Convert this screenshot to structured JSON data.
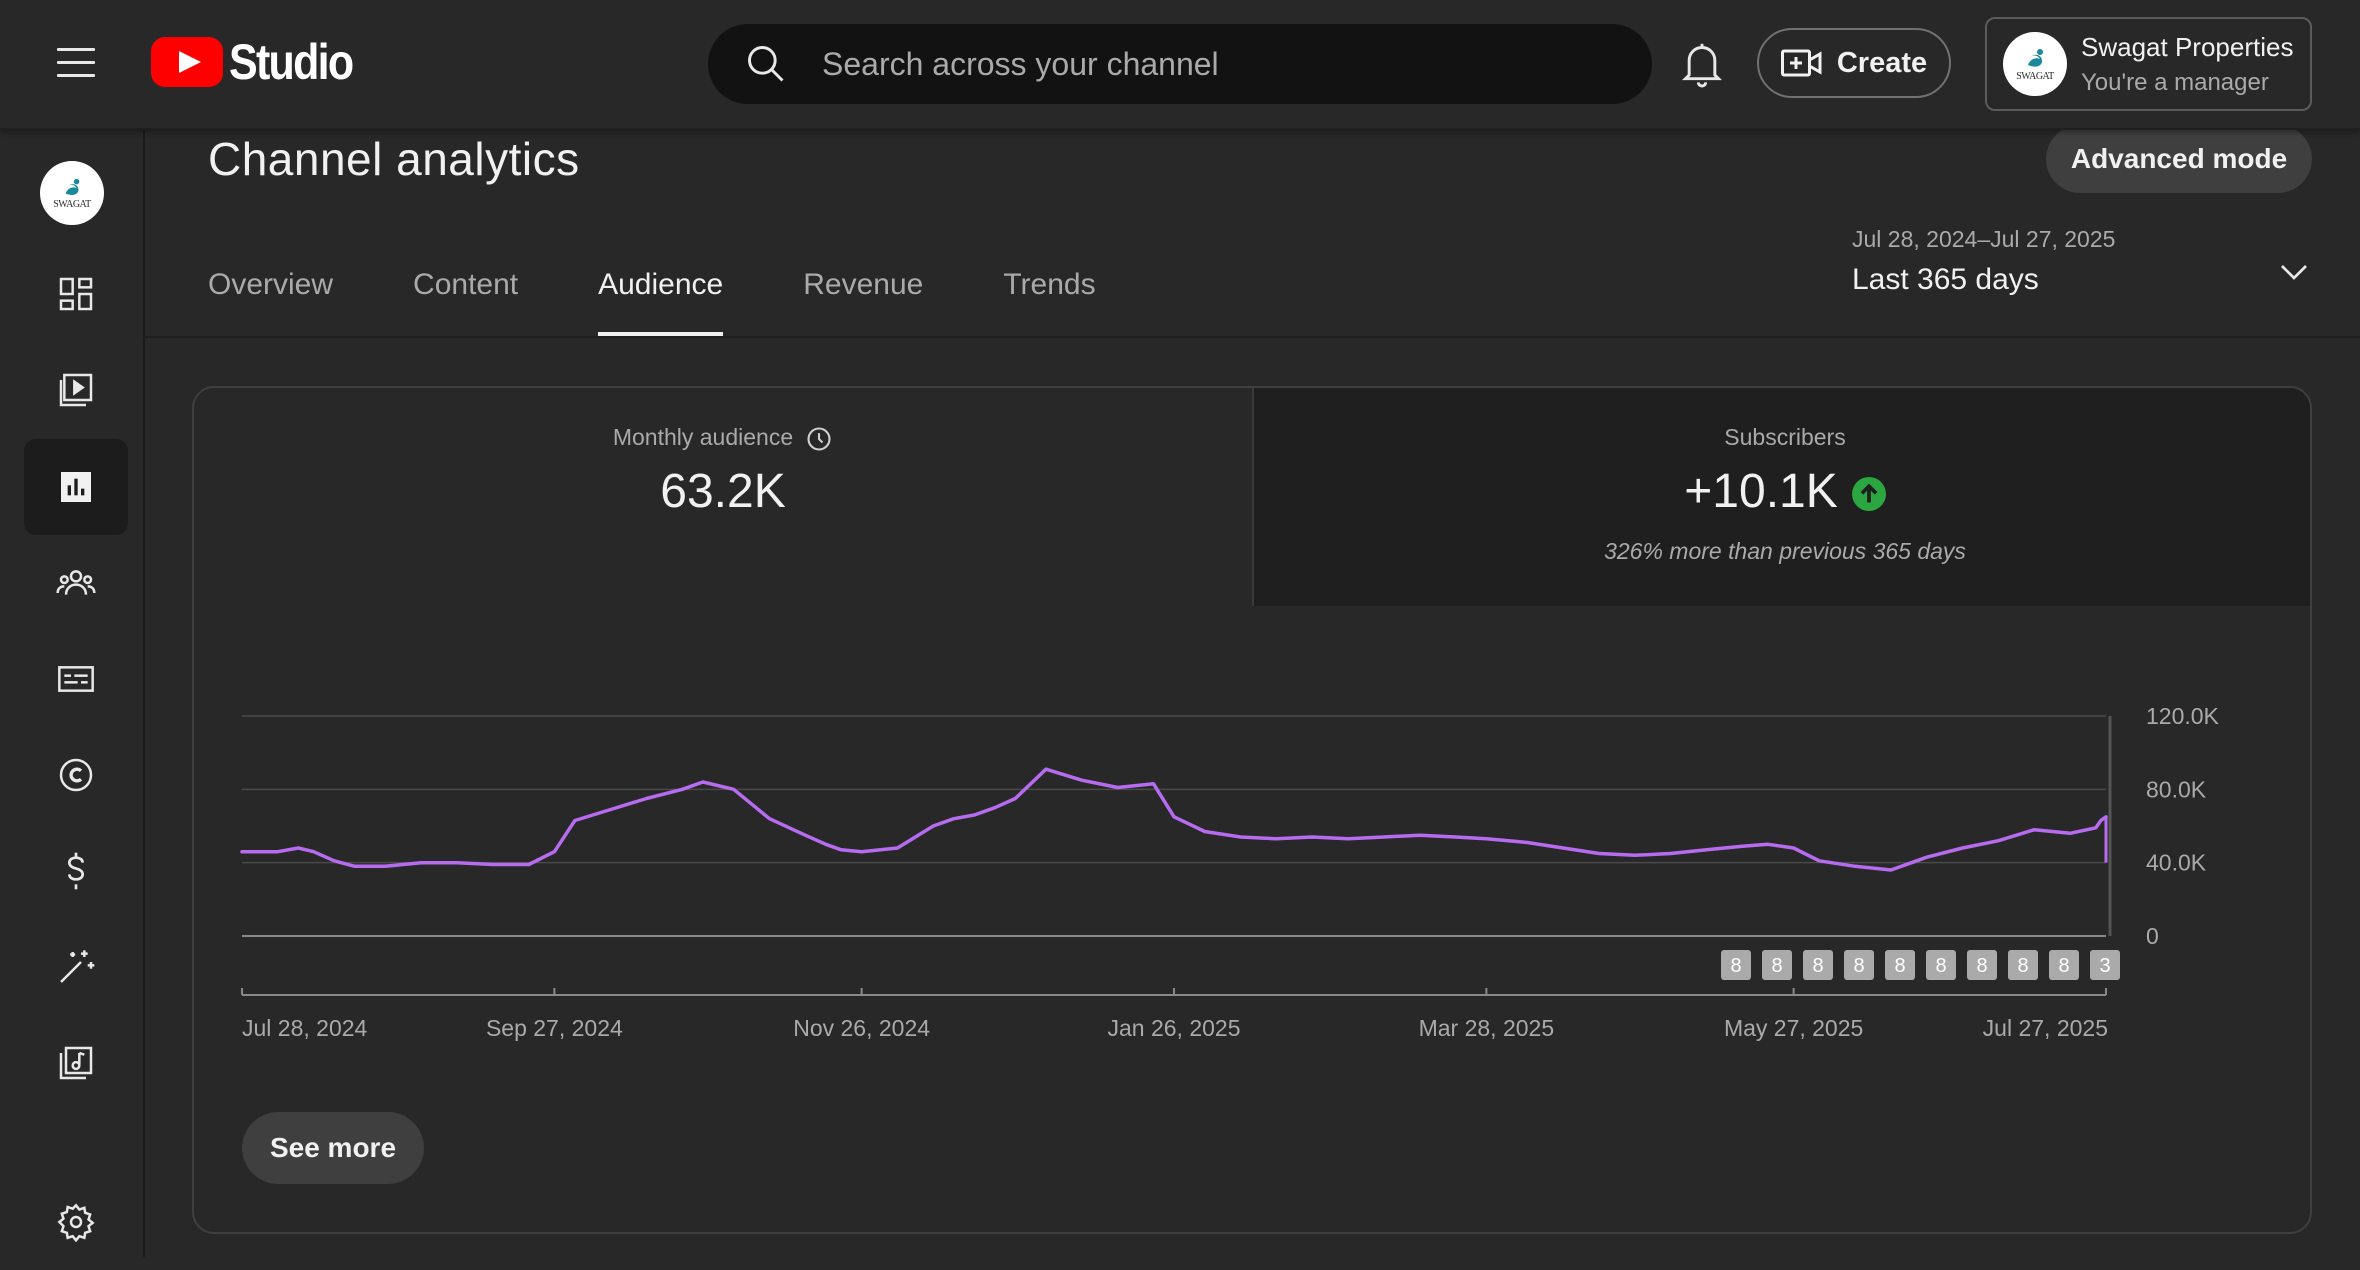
{
  "header": {
    "logo_text": "Studio",
    "search_placeholder": "Search across your channel",
    "create_label": "Create",
    "account_name": "Swagat Properties",
    "account_role": "You're a manager",
    "avatar_text": "SWAGAT"
  },
  "sidebar": {
    "items": [
      {
        "name": "dashboard",
        "icon": "dashboard-icon"
      },
      {
        "name": "content",
        "icon": "content-icon"
      },
      {
        "name": "analytics",
        "icon": "analytics-icon",
        "active": true
      },
      {
        "name": "community",
        "icon": "community-icon"
      },
      {
        "name": "subtitles",
        "icon": "subtitles-icon"
      },
      {
        "name": "copyright",
        "icon": "copyright-icon"
      },
      {
        "name": "earn",
        "icon": "dollar-icon"
      },
      {
        "name": "customization",
        "icon": "magic-wand-icon"
      },
      {
        "name": "audio-library",
        "icon": "audio-library-icon"
      },
      {
        "name": "settings",
        "icon": "gear-icon"
      }
    ]
  },
  "main": {
    "title": "Channel analytics",
    "advanced_mode_label": "Advanced mode",
    "tabs": [
      "Overview",
      "Content",
      "Audience",
      "Revenue",
      "Trends"
    ],
    "active_tab": "Audience",
    "date_range": "Jul 28, 2024–Jul 27, 2025",
    "date_period": "Last 365 days"
  },
  "metrics": {
    "monthly_audience_label": "Monthly audience",
    "monthly_audience_value": "63.2K",
    "subscribers_label": "Subscribers",
    "subscribers_value": "+10.1K",
    "subscribers_note": "326% more than previous 365 days"
  },
  "see_more_label": "See more",
  "colors": {
    "line": "#b76cf0",
    "up_badge": "#2ba640",
    "accent_red": "#ff0000"
  },
  "chart_data": {
    "type": "line",
    "title": "",
    "ylim": [
      0,
      120000
    ],
    "y_ticks": [
      "120.0K",
      "80.0K",
      "40.0K",
      "0"
    ],
    "y_tick_values": [
      120000,
      80000,
      40000,
      0
    ],
    "x_range": [
      "2024-07-28",
      "2025-07-27"
    ],
    "x_tick_labels": [
      "Jul 28, 2024",
      "Sep 27, 2024",
      "Nov 26, 2024",
      "Jan 26, 2025",
      "Mar 28, 2025",
      "May 27, 2025",
      "Jul 27, 2025"
    ],
    "x_tick_dates": [
      "2024-07-28",
      "2024-09-27",
      "2024-11-26",
      "2025-01-26",
      "2025-03-28",
      "2025-05-27",
      "2025-07-27"
    ],
    "series": [
      {
        "x": [
          "2024-07-28",
          "2024-08-04",
          "2024-08-08",
          "2024-08-11",
          "2024-08-15",
          "2024-08-19",
          "2024-08-25",
          "2024-09-01",
          "2024-09-08",
          "2024-09-15",
          "2024-09-22",
          "2024-09-27",
          "2024-10-01",
          "2024-10-08",
          "2024-10-15",
          "2024-10-22",
          "2024-10-26",
          "2024-11-01",
          "2024-11-08",
          "2024-11-15",
          "2024-11-19",
          "2024-11-22",
          "2024-11-26",
          "2024-12-03",
          "2024-12-10",
          "2024-12-14",
          "2024-12-18",
          "2024-12-22",
          "2024-12-26",
          "2025-01-01",
          "2025-01-08",
          "2025-01-15",
          "2025-01-22",
          "2025-01-26",
          "2025-02-01",
          "2025-02-08",
          "2025-02-15",
          "2025-02-22",
          "2025-03-01",
          "2025-03-08",
          "2025-03-15",
          "2025-03-22",
          "2025-03-28",
          "2025-04-05",
          "2025-04-12",
          "2025-04-19",
          "2025-04-26",
          "2025-05-03",
          "2025-05-10",
          "2025-05-17",
          "2025-05-22",
          "2025-05-27",
          "2025-06-01",
          "2025-06-08",
          "2025-06-15",
          "2025-06-22",
          "2025-06-29",
          "2025-07-06",
          "2025-07-13",
          "2025-07-20",
          "2025-07-25",
          "2025-07-26",
          "2025-07-27"
        ],
        "values": [
          46000,
          46000,
          48000,
          46000,
          41000,
          38000,
          38000,
          40000,
          40000,
          39000,
          39000,
          46000,
          63000,
          69000,
          75000,
          80000,
          84000,
          80000,
          64000,
          55000,
          50000,
          47000,
          46000,
          48000,
          60000,
          64000,
          66000,
          70000,
          75000,
          91000,
          85000,
          81000,
          83000,
          65000,
          57000,
          54000,
          53000,
          54000,
          53000,
          54000,
          55000,
          54000,
          53000,
          51000,
          48000,
          45000,
          44000,
          45000,
          47000,
          49000,
          50000,
          48000,
          41000,
          38000,
          36000,
          43000,
          48000,
          52000,
          58000,
          56000,
          59000,
          63000,
          65000
        ]
      }
    ],
    "bottom_badges": [
      "8",
      "8",
      "8",
      "8",
      "8",
      "8",
      "8",
      "8",
      "8",
      "3"
    ]
  }
}
